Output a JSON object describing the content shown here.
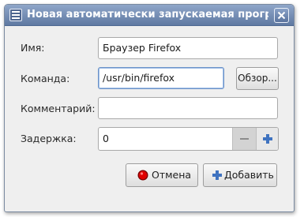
{
  "window": {
    "title": "Новая автоматически запускаемая програ",
    "app_icon": "window-app-icon",
    "close_icon": "close-icon"
  },
  "form": {
    "name_label": "Имя:",
    "name_value": "Браузер Firefox",
    "command_label": "Команда:",
    "command_value": "/usr/bin/firefox",
    "browse_label": "Обзор...",
    "comment_label": "Комментарий:",
    "comment_value": "",
    "delay_label": "Задержка:",
    "delay_value": "0",
    "delay_minus_icon": "minus-icon",
    "delay_plus_icon": "plus-icon"
  },
  "actions": {
    "cancel_label": "Отмена",
    "cancel_icon": "cancel-icon",
    "add_label": "Добавить",
    "add_icon": "plus-icon"
  },
  "colors": {
    "titlebar": "#6f88b1",
    "accent": "#3f73c0",
    "cancel_red": "#d50000"
  }
}
